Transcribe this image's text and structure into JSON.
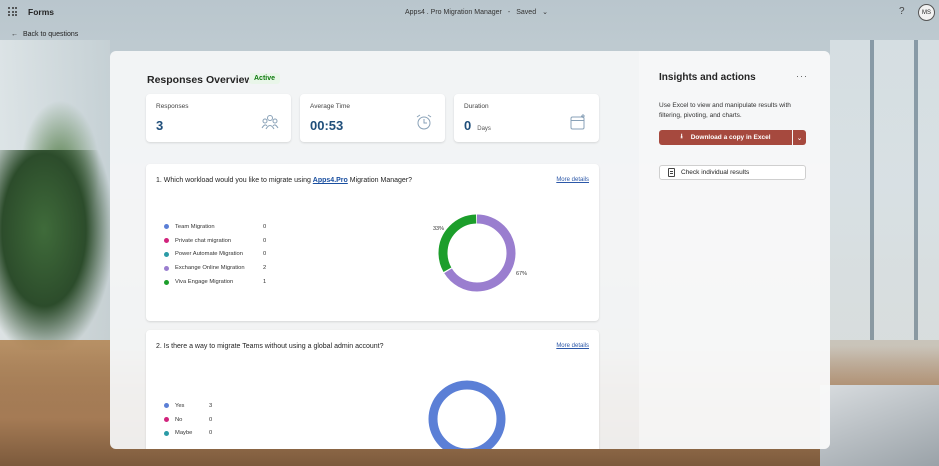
{
  "app": {
    "name": "Forms"
  },
  "header": {
    "doc_title": "Apps4 . Pro Migration Manager",
    "save_state": "Saved",
    "user_initials": "MS",
    "help_label": "?"
  },
  "nav": {
    "back_label": "Back to questions"
  },
  "overview": {
    "title": "Responses Overview",
    "status": "Active",
    "stats": [
      {
        "label": "Responses",
        "value": "3",
        "unit": "",
        "icon": "people-icon"
      },
      {
        "label": "Average Time",
        "value": "00:53",
        "unit": "",
        "icon": "alarm-clock-icon"
      },
      {
        "label": "Duration",
        "value": "0",
        "unit": "Days",
        "icon": "calendar-icon"
      }
    ]
  },
  "questions": [
    {
      "prefix": "1. Which workload would you like to migrate using ",
      "link": "Apps4.Pro",
      "suffix": " Migration Manager?",
      "more": "More details",
      "options": [
        {
          "name": "Team Migration",
          "count": "0",
          "color": "#5b7fd6"
        },
        {
          "name": "Private chat migration",
          "count": "0",
          "color": "#d1237c"
        },
        {
          "name": "Power Automate Migration",
          "count": "0",
          "color": "#2b9ba6"
        },
        {
          "name": "Exchange Online Migration",
          "count": "2",
          "color": "#9a7ecf"
        },
        {
          "name": "Viva Engage Migration",
          "count": "1",
          "color": "#1c9e2b"
        }
      ],
      "slices": [
        {
          "label": "67%",
          "fraction": 0.6667,
          "color": "#9a7ecf"
        },
        {
          "label": "33%",
          "fraction": 0.3333,
          "color": "#1c9e2b"
        }
      ]
    },
    {
      "text": "2. Is there a way to migrate Teams without using a global admin account?",
      "more": "More details",
      "options": [
        {
          "name": "Yes",
          "count": "3",
          "color": "#5b7fd6"
        },
        {
          "name": "No",
          "count": "0",
          "color": "#d1237c"
        },
        {
          "name": "Maybe",
          "count": "0",
          "color": "#2b9ba6"
        }
      ],
      "slices": [
        {
          "label": "",
          "fraction": 1.0,
          "color": "#5b7fd6"
        }
      ]
    }
  ],
  "insights": {
    "title": "Insights and actions",
    "more": "···",
    "description": "Use Excel to view and manipulate results with filtering, pivoting, and charts.",
    "download_label": "Download a copy in Excel",
    "check_label": "Check individual results"
  }
}
